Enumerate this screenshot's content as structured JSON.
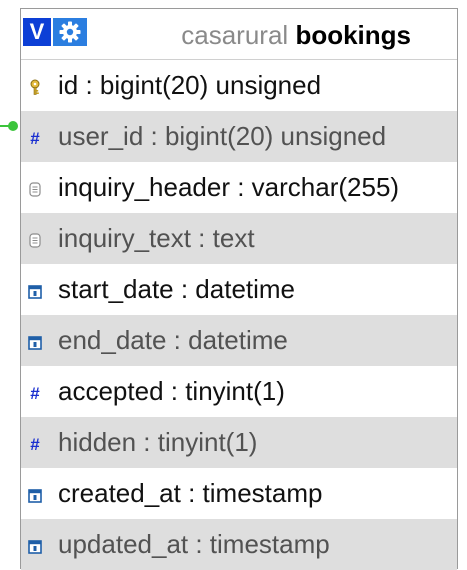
{
  "table": {
    "database": "casarural",
    "name": "bookings",
    "view_button_label": "V",
    "columns": [
      {
        "label": "id : bigint(20) unsigned",
        "icon": "primary-key-icon",
        "shaded": false
      },
      {
        "label": "user_id : bigint(20) unsigned",
        "icon": "numeric-hash-icon",
        "shaded": true
      },
      {
        "label": "inquiry_header : varchar(255)",
        "icon": "text-column-icon",
        "shaded": false
      },
      {
        "label": "inquiry_text : text",
        "icon": "text-column-icon",
        "shaded": true
      },
      {
        "label": "start_date : datetime",
        "icon": "calendar-icon",
        "shaded": false
      },
      {
        "label": "end_date : datetime",
        "icon": "calendar-icon",
        "shaded": true
      },
      {
        "label": "accepted : tinyint(1)",
        "icon": "numeric-hash-icon",
        "shaded": false
      },
      {
        "label": "hidden : tinyint(1)",
        "icon": "numeric-hash-icon",
        "shaded": true
      },
      {
        "label": "created_at : timestamp",
        "icon": "calendar-icon",
        "shaded": false
      },
      {
        "label": "updated_at : timestamp",
        "icon": "calendar-icon",
        "shaded": true
      }
    ]
  },
  "colors": {
    "view_button": "#0d3fd6",
    "settings_button": "#2b7ee0",
    "connector": "#3cc43c",
    "hash_icon": "#1a2fd0",
    "calendar_icon": "#1f5fa8",
    "key_icon": "#c9a227",
    "row_shade": "#dedede"
  }
}
